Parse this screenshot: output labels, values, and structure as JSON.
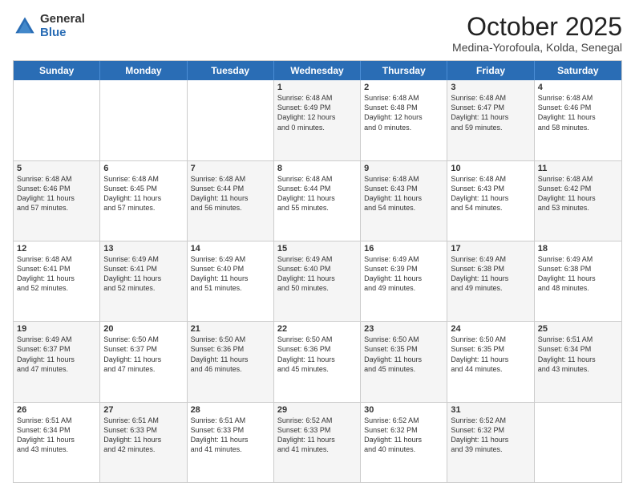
{
  "logo": {
    "general": "General",
    "blue": "Blue"
  },
  "title": {
    "month": "October 2025",
    "location": "Medina-Yorofoula, Kolda, Senegal"
  },
  "weekdays": [
    "Sunday",
    "Monday",
    "Tuesday",
    "Wednesday",
    "Thursday",
    "Friday",
    "Saturday"
  ],
  "rows": [
    [
      {
        "day": "",
        "info": "",
        "shaded": false
      },
      {
        "day": "",
        "info": "",
        "shaded": false
      },
      {
        "day": "",
        "info": "",
        "shaded": false
      },
      {
        "day": "1",
        "info": "Sunrise: 6:48 AM\nSunset: 6:49 PM\nDaylight: 12 hours\nand 0 minutes.",
        "shaded": true
      },
      {
        "day": "2",
        "info": "Sunrise: 6:48 AM\nSunset: 6:48 PM\nDaylight: 12 hours\nand 0 minutes.",
        "shaded": false
      },
      {
        "day": "3",
        "info": "Sunrise: 6:48 AM\nSunset: 6:47 PM\nDaylight: 11 hours\nand 59 minutes.",
        "shaded": true
      },
      {
        "day": "4",
        "info": "Sunrise: 6:48 AM\nSunset: 6:46 PM\nDaylight: 11 hours\nand 58 minutes.",
        "shaded": false
      }
    ],
    [
      {
        "day": "5",
        "info": "Sunrise: 6:48 AM\nSunset: 6:46 PM\nDaylight: 11 hours\nand 57 minutes.",
        "shaded": true
      },
      {
        "day": "6",
        "info": "Sunrise: 6:48 AM\nSunset: 6:45 PM\nDaylight: 11 hours\nand 57 minutes.",
        "shaded": false
      },
      {
        "day": "7",
        "info": "Sunrise: 6:48 AM\nSunset: 6:44 PM\nDaylight: 11 hours\nand 56 minutes.",
        "shaded": true
      },
      {
        "day": "8",
        "info": "Sunrise: 6:48 AM\nSunset: 6:44 PM\nDaylight: 11 hours\nand 55 minutes.",
        "shaded": false
      },
      {
        "day": "9",
        "info": "Sunrise: 6:48 AM\nSunset: 6:43 PM\nDaylight: 11 hours\nand 54 minutes.",
        "shaded": true
      },
      {
        "day": "10",
        "info": "Sunrise: 6:48 AM\nSunset: 6:43 PM\nDaylight: 11 hours\nand 54 minutes.",
        "shaded": false
      },
      {
        "day": "11",
        "info": "Sunrise: 6:48 AM\nSunset: 6:42 PM\nDaylight: 11 hours\nand 53 minutes.",
        "shaded": true
      }
    ],
    [
      {
        "day": "12",
        "info": "Sunrise: 6:48 AM\nSunset: 6:41 PM\nDaylight: 11 hours\nand 52 minutes.",
        "shaded": false
      },
      {
        "day": "13",
        "info": "Sunrise: 6:49 AM\nSunset: 6:41 PM\nDaylight: 11 hours\nand 52 minutes.",
        "shaded": true
      },
      {
        "day": "14",
        "info": "Sunrise: 6:49 AM\nSunset: 6:40 PM\nDaylight: 11 hours\nand 51 minutes.",
        "shaded": false
      },
      {
        "day": "15",
        "info": "Sunrise: 6:49 AM\nSunset: 6:40 PM\nDaylight: 11 hours\nand 50 minutes.",
        "shaded": true
      },
      {
        "day": "16",
        "info": "Sunrise: 6:49 AM\nSunset: 6:39 PM\nDaylight: 11 hours\nand 49 minutes.",
        "shaded": false
      },
      {
        "day": "17",
        "info": "Sunrise: 6:49 AM\nSunset: 6:38 PM\nDaylight: 11 hours\nand 49 minutes.",
        "shaded": true
      },
      {
        "day": "18",
        "info": "Sunrise: 6:49 AM\nSunset: 6:38 PM\nDaylight: 11 hours\nand 48 minutes.",
        "shaded": false
      }
    ],
    [
      {
        "day": "19",
        "info": "Sunrise: 6:49 AM\nSunset: 6:37 PM\nDaylight: 11 hours\nand 47 minutes.",
        "shaded": true
      },
      {
        "day": "20",
        "info": "Sunrise: 6:50 AM\nSunset: 6:37 PM\nDaylight: 11 hours\nand 47 minutes.",
        "shaded": false
      },
      {
        "day": "21",
        "info": "Sunrise: 6:50 AM\nSunset: 6:36 PM\nDaylight: 11 hours\nand 46 minutes.",
        "shaded": true
      },
      {
        "day": "22",
        "info": "Sunrise: 6:50 AM\nSunset: 6:36 PM\nDaylight: 11 hours\nand 45 minutes.",
        "shaded": false
      },
      {
        "day": "23",
        "info": "Sunrise: 6:50 AM\nSunset: 6:35 PM\nDaylight: 11 hours\nand 45 minutes.",
        "shaded": true
      },
      {
        "day": "24",
        "info": "Sunrise: 6:50 AM\nSunset: 6:35 PM\nDaylight: 11 hours\nand 44 minutes.",
        "shaded": false
      },
      {
        "day": "25",
        "info": "Sunrise: 6:51 AM\nSunset: 6:34 PM\nDaylight: 11 hours\nand 43 minutes.",
        "shaded": true
      }
    ],
    [
      {
        "day": "26",
        "info": "Sunrise: 6:51 AM\nSunset: 6:34 PM\nDaylight: 11 hours\nand 43 minutes.",
        "shaded": false
      },
      {
        "day": "27",
        "info": "Sunrise: 6:51 AM\nSunset: 6:33 PM\nDaylight: 11 hours\nand 42 minutes.",
        "shaded": true
      },
      {
        "day": "28",
        "info": "Sunrise: 6:51 AM\nSunset: 6:33 PM\nDaylight: 11 hours\nand 41 minutes.",
        "shaded": false
      },
      {
        "day": "29",
        "info": "Sunrise: 6:52 AM\nSunset: 6:33 PM\nDaylight: 11 hours\nand 41 minutes.",
        "shaded": true
      },
      {
        "day": "30",
        "info": "Sunrise: 6:52 AM\nSunset: 6:32 PM\nDaylight: 11 hours\nand 40 minutes.",
        "shaded": false
      },
      {
        "day": "31",
        "info": "Sunrise: 6:52 AM\nSunset: 6:32 PM\nDaylight: 11 hours\nand 39 minutes.",
        "shaded": true
      },
      {
        "day": "",
        "info": "",
        "shaded": false
      }
    ]
  ]
}
